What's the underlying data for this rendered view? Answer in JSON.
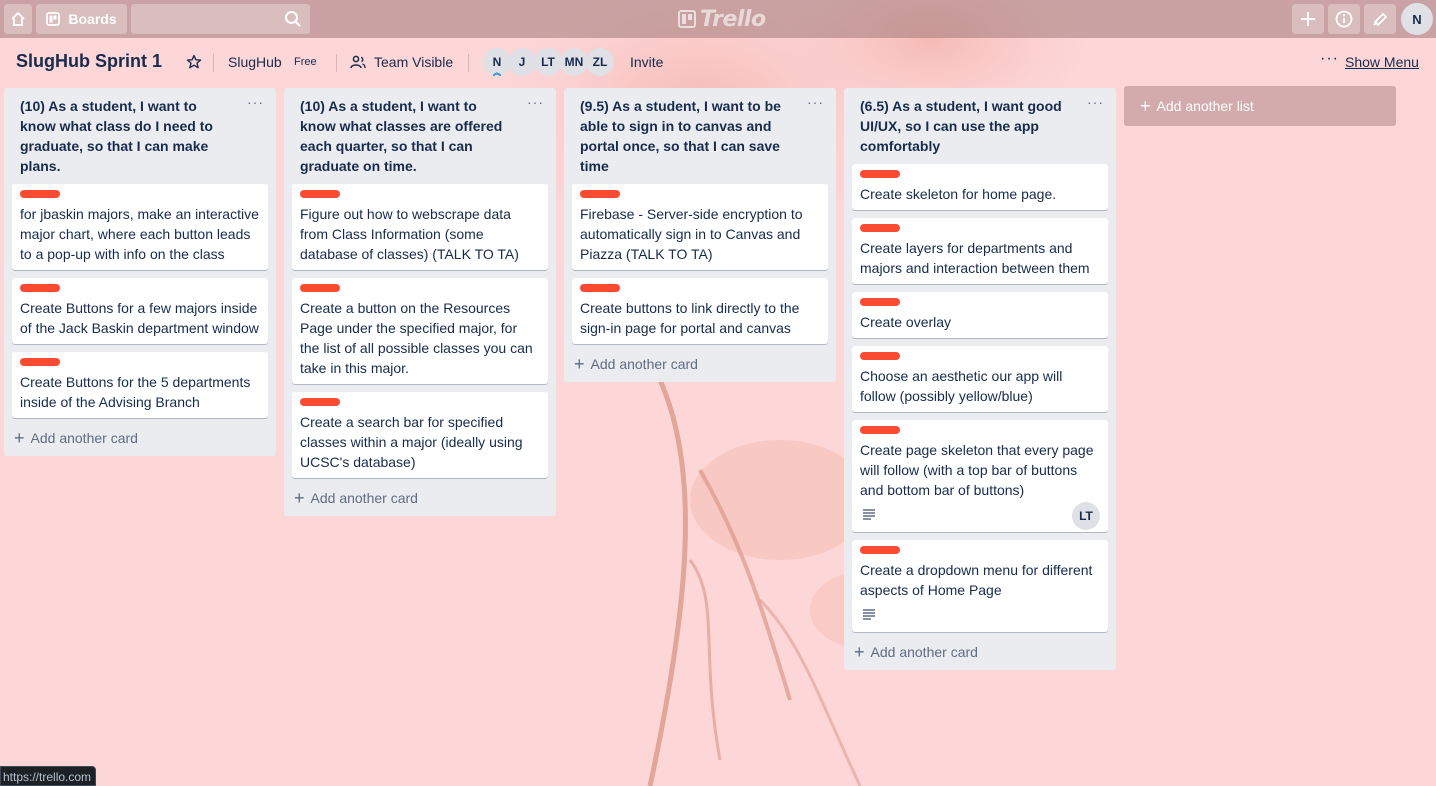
{
  "topbar": {
    "boards_label": "Boards",
    "logo_text": "Trello",
    "user_initial": "N"
  },
  "board": {
    "title": "SlugHub Sprint 1",
    "team": "SlugHub",
    "team_badge": "Free",
    "visibility": "Team Visible",
    "members": [
      "N",
      "J",
      "LT",
      "MN",
      "ZL"
    ],
    "invite": "Invite",
    "show_menu": "Show Menu"
  },
  "lists": [
    {
      "title": "(10) As a student, I want to know what class do I need to graduate, so that I can make plans.",
      "cards": [
        {
          "text": "for jbaskin majors, make an interactive major chart, where each button leads to a pop-up with info on the class"
        },
        {
          "text": "Create Buttons for a few majors inside of the Jack Baskin department window"
        },
        {
          "text": "Create Buttons for the 5 departments inside of the Advising Branch"
        }
      ],
      "add_card": "Add another card"
    },
    {
      "title": "(10) As a student, I want to know what classes are offered each quarter, so that I can graduate on time.",
      "cards": [
        {
          "text": "Figure out how to webscrape data from Class Information (some database of classes) (TALK TO TA)"
        },
        {
          "text": "Create a button on the Resources Page under the specified major, for the list of all possible classes you can take in this major."
        },
        {
          "text": "Create a search bar for specified classes within a major (ideally using UCSC's database)"
        }
      ],
      "add_card": "Add another card"
    },
    {
      "title": "(9.5) As a student, I want to be able to sign in to canvas and portal once, so that I can save time",
      "cards": [
        {
          "text": "Firebase - Server-side encryption to automatically sign in to Canvas and Piazza (TALK TO TA)"
        },
        {
          "text": "Create buttons to link directly to the sign-in page for portal and canvas"
        }
      ],
      "add_card": "Add another card"
    },
    {
      "title": "(6.5) As a student, I want good UI/UX, so I can use the app comfortably",
      "cards": [
        {
          "text": "Create skeleton for home page."
        },
        {
          "text": "Create layers for departments and majors and interaction between them"
        },
        {
          "text": "Create overlay"
        },
        {
          "text": "Choose an aesthetic our app will follow (possibly yellow/blue)"
        },
        {
          "text": "Create page skeleton that every page will follow (with a top bar of buttons and bottom bar of buttons)",
          "member": "LT"
        },
        {
          "text": "Create a dropdown menu for different aspects of Home Page"
        }
      ],
      "add_card": "Add another card"
    }
  ],
  "add_list": "Add another list",
  "status_url": "https://trello.com",
  "colors": {
    "label_red": "#f94a32",
    "list_bg": "#ebecf0",
    "board_bg": "#fcd5d8"
  }
}
